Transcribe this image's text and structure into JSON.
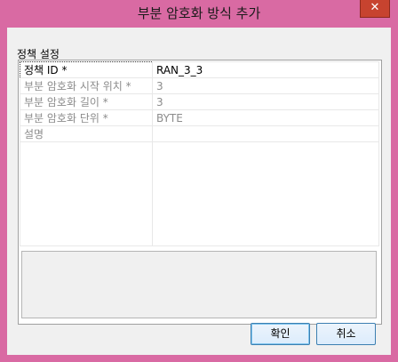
{
  "window": {
    "title": "부분 암호화 방식 추가",
    "close_glyph": "✕"
  },
  "section": {
    "label": "정책 설정"
  },
  "properties": [
    {
      "key": "정책 ID *",
      "value": "RAN_3_3"
    },
    {
      "key": "부분 암호화 시작 위치 *",
      "value": "3"
    },
    {
      "key": "부분 암호화 길이 *",
      "value": "3"
    },
    {
      "key": "부분 암호화 단위 *",
      "value": "BYTE"
    },
    {
      "key": "설명",
      "value": ""
    }
  ],
  "buttons": {
    "ok": "확인",
    "cancel": "취소"
  },
  "colors": {
    "frame": "#d96aa3",
    "close": "#c7432f",
    "button_border": "#3c7fb1"
  }
}
